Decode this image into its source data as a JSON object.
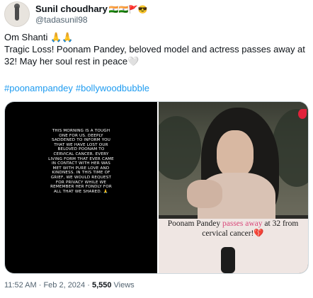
{
  "author": {
    "display_name": "Sunil choudhary",
    "name_emojis": "🇮🇳🇮🇳🚩😎",
    "handle": "@tadasunil98"
  },
  "tweet": {
    "line1": "Om Shanti 🙏🙏",
    "line2": "Tragic Loss! Poonam Pandey, beloved model and actress passes away at 32! May her soul rest in peace🤍",
    "hashtags": [
      "#poonampandey",
      "#bollywoodbubble"
    ]
  },
  "media": {
    "left_story_text": "THIS MORNING IS A TOUGH ONE FOR US. DEEPLY SADDENED TO INFORM YOU THAT WE HAVE LOST OUR BELOVED POONAM TO CERVICAL CANCER. EVERY LIVING FORM THAT EVER CAME IN CONTACT WITH HER WAS MET WITH PURE LOVE AND KINDNESS. IN THIS TIME OF GRIEF, WE WOULD REQUEST FOR PRIVACY WHILE WE REMEMBER HER FONDLY FOR ALL THAT WE SHARED. 🙏",
    "right_caption_part1": "Poonam Pandey ",
    "right_caption_highlight": "passes away",
    "right_caption_part2": " at 32 from cervical cancer!💔"
  },
  "footer": {
    "time": "11:52 AM",
    "date": "Feb 2, 2024",
    "separator": " · ",
    "views_count": "5,550",
    "views_label": " Views"
  }
}
